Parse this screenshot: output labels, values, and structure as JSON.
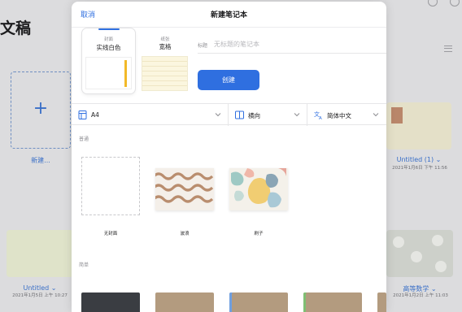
{
  "background": {
    "page_title": "文稿",
    "new_label": "新建...",
    "new_plus": "+",
    "docs": [
      {
        "name": "Untitled (1) ⌄",
        "date": "2021年1月6日 下午 11:56"
      },
      {
        "name": "Untitled ⌄",
        "date": "2021年1月5日 上午 10:27"
      },
      {
        "name": "高等数学 ⌄",
        "date": "2021年1月2日 上午 11:03"
      }
    ]
  },
  "modal": {
    "cancel": "取消",
    "title": "新建笔记本",
    "cover": {
      "sub": "封面",
      "name": "实线白色"
    },
    "paper": {
      "sub": "纸张",
      "name": "宽格"
    },
    "title_field": {
      "label": "标题",
      "placeholder": "无标题的笔记本",
      "value": ""
    },
    "create": "创建",
    "options": {
      "size": "A4",
      "orientation": "横向",
      "language": "简体中文"
    },
    "sections": {
      "standard": "普通",
      "simple": "简单"
    },
    "covers": [
      {
        "caption": "无封面"
      },
      {
        "caption": "波浪"
      },
      {
        "caption": "刷子"
      }
    ]
  },
  "colors": {
    "accent": "#2f6fe0",
    "cover_stripe": "#f2b928",
    "paper": "#fbf6df",
    "wave": "#b98d6e"
  },
  "icons": [
    "page-size-icon",
    "orientation-icon",
    "language-icon",
    "chevron-down-icon",
    "plus-icon",
    "list-view-icon"
  ]
}
